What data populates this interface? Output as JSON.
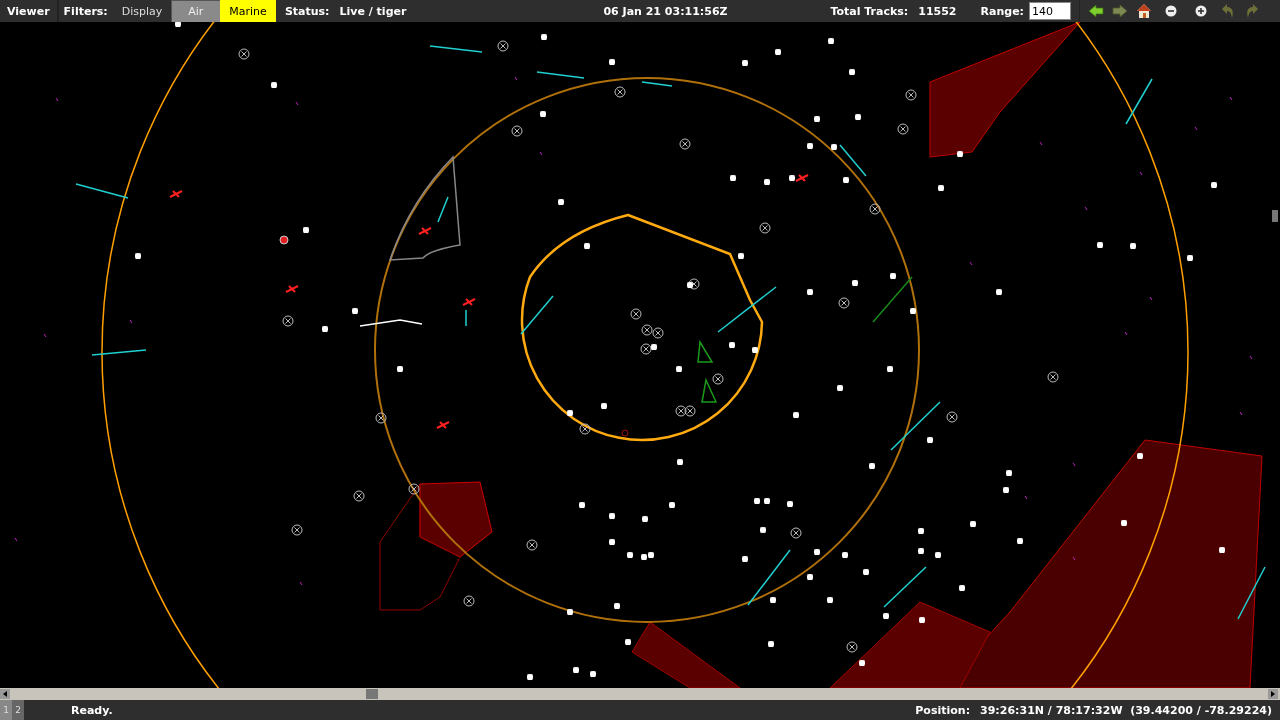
{
  "menu": {
    "label": "Viewer"
  },
  "filters": {
    "label": "Filters:",
    "items": [
      {
        "label": "Display",
        "selected": false,
        "highlighted": false
      },
      {
        "label": "Air",
        "selected": true,
        "highlighted": false
      },
      {
        "label": "Marine",
        "selected": false,
        "highlighted": true
      }
    ]
  },
  "status": {
    "label": "Status:",
    "value": "Live / tiger"
  },
  "clock": "06 Jan 21 03:11:56Z",
  "total_tracks": {
    "label": "Total Tracks:",
    "value": "11552"
  },
  "range": {
    "label": "Range:",
    "value": "140"
  },
  "toolbar": [
    {
      "kind": "back",
      "disabled": false
    },
    {
      "kind": "forward",
      "disabled": true
    },
    {
      "kind": "home",
      "disabled": false
    },
    {
      "kind": "zoom-out",
      "disabled": false
    },
    {
      "kind": "zoom-in",
      "disabled": false
    },
    {
      "kind": "undo",
      "disabled": true
    },
    {
      "kind": "redo",
      "disabled": true
    }
  ],
  "pages": [
    {
      "label": "1",
      "selected": true
    },
    {
      "label": "2",
      "selected": false
    }
  ],
  "status_bar": {
    "message": "Ready.",
    "position_label": "Position:",
    "position_value": "39:26:31N / 78:17:32W  (39.44200 / -78.29224)"
  }
}
